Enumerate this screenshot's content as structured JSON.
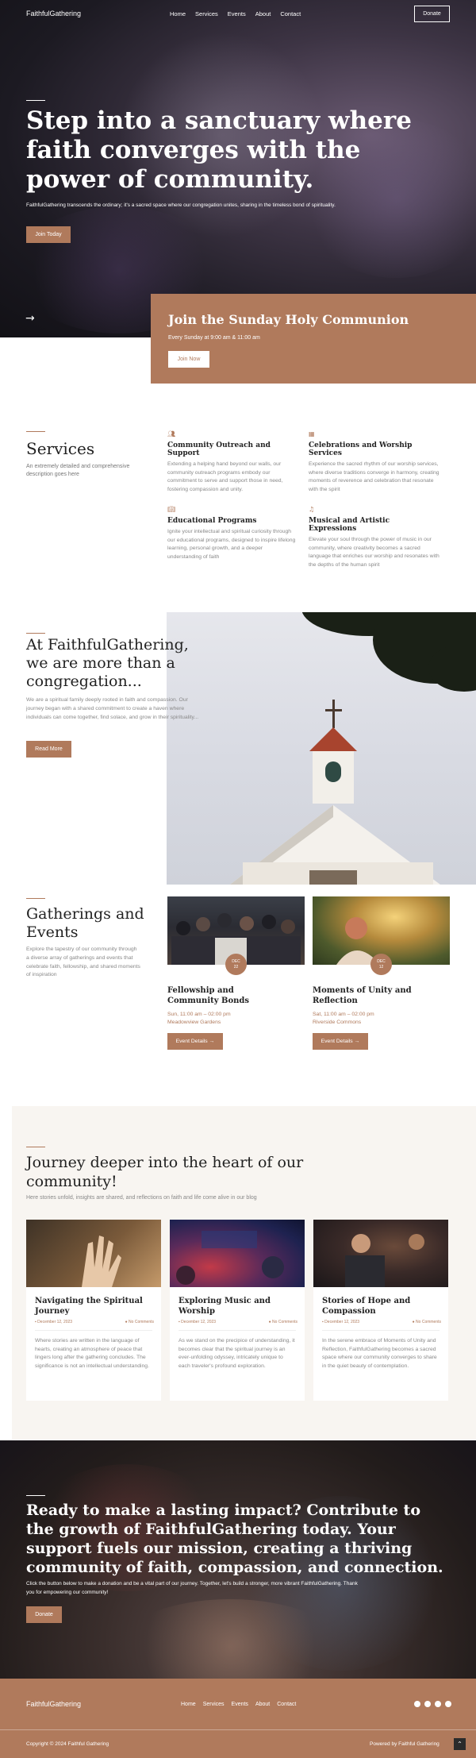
{
  "nav": {
    "brand": "FaithfulGathering",
    "links": [
      "Home",
      "Services",
      "Events",
      "About",
      "Contact"
    ],
    "donate": "Donate"
  },
  "hero": {
    "title": "Step into a sanctuary where faith converges with the power of community.",
    "subtitle": "FaithfulGathering transcends the ordinary; it's a sacred space where our congregation unites, sharing in the timeless bond of spirituality.",
    "button": "Join Today",
    "arrow_icon": "arrow-right-icon"
  },
  "communion": {
    "title": "Join the Sunday Holy Communion",
    "subtitle": "Every Sunday at 9:00 am & 11:00 am",
    "button": "Join Now"
  },
  "services": {
    "title": "Services",
    "description": "An extremely detailed and comprehensive description goes here",
    "items": [
      {
        "icon": "people-icon",
        "title": "Community Outreach and Support",
        "text": "Extending a helping hand beyond our walls, our community outreach programs embody our commitment to serve and support those in need, fostering compassion and unity."
      },
      {
        "icon": "calendar-icon",
        "title": "Celebrations and Worship Services",
        "text": "Experience the sacred rhythm of our worship services, where diverse traditions converge in harmony, creating moments of reverence and celebration that resonate with the spirit"
      },
      {
        "icon": "book-icon",
        "title": "Educational Programs",
        "text": "Ignite your intellectual and spiritual curiosity through our educational programs, designed to inspire lifelong learning, personal growth, and a deeper understanding of faith"
      },
      {
        "icon": "music-note-icon",
        "title": "Musical and Artistic Expressions",
        "text": "Elevate your soul through the power of music in our community, where creativity becomes a sacred language that enriches our worship and resonates with the depths of the human spirit"
      }
    ]
  },
  "about": {
    "title": "At FaithfulGathering, we are more than a congregation...",
    "text": "We are a spiritual family deeply rooted in faith and compassion. Our journey began with a shared commitment to create a haven where individuals can come together, find solace, and grow in their spirituality...",
    "button": "Read More"
  },
  "events": {
    "title": "Gatherings and Events",
    "description": "Explore the tapestry of our community through a diverse array of gatherings and events that celebrate faith, fellowship, and shared moments of inspiration",
    "items": [
      {
        "month": "DEC",
        "day": "22",
        "title": "Fellowship and Community Bonds",
        "time": "Sun, 11:00 am – 02:00 pm",
        "location": "Meadowview Gardens",
        "button": "Event Details →"
      },
      {
        "month": "DEC",
        "day": "12",
        "title": "Moments of Unity and Reflection",
        "time": "Sat, 11:00 am – 02:00 pm",
        "location": "Riverside Commons",
        "button": "Event Details →"
      }
    ]
  },
  "blog": {
    "title": "Journey deeper into the heart of our community!",
    "subtitle": "Here stories unfold, insights are shared, and reflections on faith and life come alive in our blog",
    "posts": [
      {
        "title": "Navigating the Spiritual Journey",
        "date": "December 12, 2023",
        "comments": "No Comments",
        "text": "Where stories are written in the language of hearts, creating an atmosphere of peace that lingers long after the gathering concludes. The significance is not an intellectual understanding."
      },
      {
        "title": "Exploring Music and Worship",
        "date": "December 12, 2023",
        "comments": "No Comments",
        "text": "As we stand on the precipice of understanding, it becomes clear that the spiritual journey is an ever-unfolding odyssey, intricately unique to each traveler's profound exploration."
      },
      {
        "title": "Stories of Hope and Compassion",
        "date": "December 12, 2023",
        "comments": "No Comments",
        "text": "In the serene embrace of Moments of Unity and Reflection, FaithfulGathering becomes a sacred space where our community converges to share in the quiet beauty of contemplation."
      }
    ]
  },
  "cta": {
    "title": "Ready to make a lasting impact? Contribute to the growth of FaithfulGathering today. Your support fuels our mission, creating a thriving community of faith, compassion, and connection.",
    "subtitle": "Click the button below to make a donation and be a vital part of our journey. Together, let's build a stronger, more vibrant FaithfulGathering. Thank you for empowering our community!",
    "button": "Donate"
  },
  "footer": {
    "brand": "FaithfulGathering",
    "links": [
      "Home",
      "Services",
      "Events",
      "About",
      "Contact"
    ],
    "social_icons": [
      "facebook-icon",
      "twitter-icon",
      "instagram-icon",
      "youtube-icon"
    ],
    "copyright": "Copyright © 2024 Faithful Gathering",
    "powered": "Powered by Faithful Gathering"
  },
  "colors": {
    "accent": "#b07a5c",
    "cream": "#f8f5f1",
    "dark": "#222222"
  }
}
